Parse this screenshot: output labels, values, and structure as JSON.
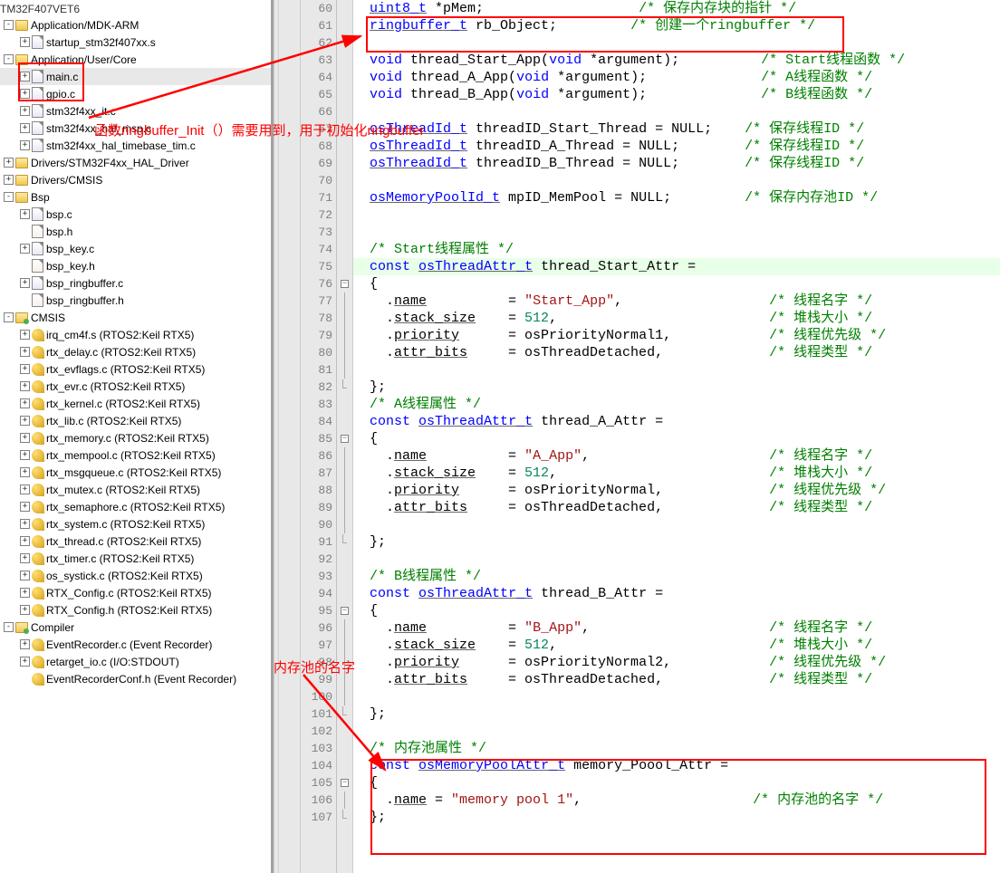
{
  "title_fragment": "TM32F407VET6",
  "tree": [
    {
      "depth": 0,
      "exp": "-",
      "icon": "folder",
      "label": "Application/MDK-ARM"
    },
    {
      "depth": 1,
      "exp": "+",
      "icon": "file-c",
      "label": "startup_stm32f407xx.s"
    },
    {
      "depth": 0,
      "exp": "-",
      "icon": "folder",
      "label": "Application/User/Core",
      "boxed": true
    },
    {
      "depth": 1,
      "exp": "+",
      "icon": "file-c",
      "label": "main.c",
      "selected": true,
      "boxed_child": true
    },
    {
      "depth": 1,
      "exp": "+",
      "icon": "file-c",
      "label": "gpio.c"
    },
    {
      "depth": 1,
      "exp": "+",
      "icon": "file-c",
      "label": "stm32f4xx_it.c"
    },
    {
      "depth": 1,
      "exp": "+",
      "icon": "file-c",
      "label": "stm32f4xx_hal_msp.c"
    },
    {
      "depth": 1,
      "exp": "+",
      "icon": "file-c",
      "label": "stm32f4xx_hal_timebase_tim.c"
    },
    {
      "depth": 0,
      "exp": "+",
      "icon": "folder",
      "label": "Drivers/STM32F4xx_HAL_Driver"
    },
    {
      "depth": 0,
      "exp": "+",
      "icon": "folder",
      "label": "Drivers/CMSIS"
    },
    {
      "depth": 0,
      "exp": "-",
      "icon": "folder",
      "label": "Bsp"
    },
    {
      "depth": 1,
      "exp": "+",
      "icon": "file-c",
      "label": "bsp.c"
    },
    {
      "depth": 1,
      "exp": "",
      "icon": "file-h",
      "label": "bsp.h"
    },
    {
      "depth": 1,
      "exp": "+",
      "icon": "file-c",
      "label": "bsp_key.c"
    },
    {
      "depth": 1,
      "exp": "",
      "icon": "file-h",
      "label": "bsp_key.h"
    },
    {
      "depth": 1,
      "exp": "+",
      "icon": "file-c",
      "label": "bsp_ringbuffer.c"
    },
    {
      "depth": 1,
      "exp": "",
      "icon": "file-h",
      "label": "bsp_ringbuffer.h"
    },
    {
      "depth": 0,
      "exp": "-",
      "icon": "folder-green",
      "label": "CMSIS"
    },
    {
      "depth": 1,
      "exp": "+",
      "icon": "key",
      "label": "irq_cm4f.s (RTOS2:Keil RTX5)"
    },
    {
      "depth": 1,
      "exp": "+",
      "icon": "key",
      "label": "rtx_delay.c (RTOS2:Keil RTX5)"
    },
    {
      "depth": 1,
      "exp": "+",
      "icon": "key",
      "label": "rtx_evflags.c (RTOS2:Keil RTX5)"
    },
    {
      "depth": 1,
      "exp": "+",
      "icon": "key",
      "label": "rtx_evr.c (RTOS2:Keil RTX5)"
    },
    {
      "depth": 1,
      "exp": "+",
      "icon": "key",
      "label": "rtx_kernel.c (RTOS2:Keil RTX5)"
    },
    {
      "depth": 1,
      "exp": "+",
      "icon": "key",
      "label": "rtx_lib.c (RTOS2:Keil RTX5)"
    },
    {
      "depth": 1,
      "exp": "+",
      "icon": "key",
      "label": "rtx_memory.c (RTOS2:Keil RTX5)"
    },
    {
      "depth": 1,
      "exp": "+",
      "icon": "key",
      "label": "rtx_mempool.c (RTOS2:Keil RTX5)"
    },
    {
      "depth": 1,
      "exp": "+",
      "icon": "key",
      "label": "rtx_msgqueue.c (RTOS2:Keil RTX5)"
    },
    {
      "depth": 1,
      "exp": "+",
      "icon": "key",
      "label": "rtx_mutex.c (RTOS2:Keil RTX5)"
    },
    {
      "depth": 1,
      "exp": "+",
      "icon": "key",
      "label": "rtx_semaphore.c (RTOS2:Keil RTX5)"
    },
    {
      "depth": 1,
      "exp": "+",
      "icon": "key",
      "label": "rtx_system.c (RTOS2:Keil RTX5)"
    },
    {
      "depth": 1,
      "exp": "+",
      "icon": "key",
      "label": "rtx_thread.c (RTOS2:Keil RTX5)"
    },
    {
      "depth": 1,
      "exp": "+",
      "icon": "key",
      "label": "rtx_timer.c (RTOS2:Keil RTX5)"
    },
    {
      "depth": 1,
      "exp": "+",
      "icon": "key",
      "label": "os_systick.c (RTOS2:Keil RTX5)"
    },
    {
      "depth": 1,
      "exp": "+",
      "icon": "key",
      "label": "RTX_Config.c (RTOS2:Keil RTX5)"
    },
    {
      "depth": 1,
      "exp": "+",
      "icon": "key",
      "label": "RTX_Config.h (RTOS2:Keil RTX5)"
    },
    {
      "depth": 0,
      "exp": "-",
      "icon": "folder-green",
      "label": "Compiler"
    },
    {
      "depth": 1,
      "exp": "+",
      "icon": "key",
      "label": "EventRecorder.c (Event Recorder)"
    },
    {
      "depth": 1,
      "exp": "+",
      "icon": "key",
      "label": "retarget_io.c (I/O:STDOUT)"
    },
    {
      "depth": 1,
      "exp": "",
      "icon": "key",
      "label": "EventRecorderConf.h (Event Recorder)"
    }
  ],
  "code": [
    {
      "n": 60,
      "fold": "",
      "tokens": [
        {
          "p": "  "
        },
        {
          "c": "ty u",
          "t": "uint8_t"
        },
        {
          "p": " *pMem;                   "
        },
        {
          "c": "cmt",
          "t": "/* 保存内存块的指针 */"
        }
      ]
    },
    {
      "n": 61,
      "fold": "",
      "tokens": [
        {
          "p": "  "
        },
        {
          "c": "ty u",
          "t": "ringbuffer_t"
        },
        {
          "p": " rb_Object;         "
        },
        {
          "c": "cmt",
          "t": "/* 创建一个ringbuffer */"
        }
      ]
    },
    {
      "n": 62,
      "fold": "",
      "tokens": []
    },
    {
      "n": 63,
      "fold": "",
      "tokens": [
        {
          "p": "  "
        },
        {
          "c": "kw",
          "t": "void"
        },
        {
          "p": " thread_Start_App("
        },
        {
          "c": "kw",
          "t": "void"
        },
        {
          "p": " *argument);          "
        },
        {
          "c": "cmt",
          "t": "/* Start线程函数 */"
        }
      ]
    },
    {
      "n": 64,
      "fold": "",
      "tokens": [
        {
          "p": "  "
        },
        {
          "c": "kw",
          "t": "void"
        },
        {
          "p": " thread_A_App("
        },
        {
          "c": "kw",
          "t": "void"
        },
        {
          "p": " *argument);              "
        },
        {
          "c": "cmt",
          "t": "/* A线程函数 */"
        }
      ]
    },
    {
      "n": 65,
      "fold": "",
      "tokens": [
        {
          "p": "  "
        },
        {
          "c": "kw",
          "t": "void"
        },
        {
          "p": " thread_B_App("
        },
        {
          "c": "kw",
          "t": "void"
        },
        {
          "p": " *argument);              "
        },
        {
          "c": "cmt",
          "t": "/* B线程函数 */"
        }
      ]
    },
    {
      "n": 66,
      "fold": "",
      "tokens": []
    },
    {
      "n": 67,
      "fold": "",
      "tokens": [
        {
          "p": "  "
        },
        {
          "c": "ty u",
          "t": "osThreadId_t"
        },
        {
          "p": " threadID_Start_Thread = NULL;    "
        },
        {
          "c": "cmt",
          "t": "/* 保存线程ID */"
        }
      ]
    },
    {
      "n": 68,
      "fold": "",
      "tokens": [
        {
          "p": "  "
        },
        {
          "c": "ty u",
          "t": "osThreadId_t"
        },
        {
          "p": " threadID_A_Thread = NULL;        "
        },
        {
          "c": "cmt",
          "t": "/* 保存线程ID */"
        }
      ]
    },
    {
      "n": 69,
      "fold": "",
      "tokens": [
        {
          "p": "  "
        },
        {
          "c": "ty u",
          "t": "osThreadId_t"
        },
        {
          "p": " threadID_B_Thread = NULL;        "
        },
        {
          "c": "cmt",
          "t": "/* 保存线程ID */"
        }
      ]
    },
    {
      "n": 70,
      "fold": "",
      "tokens": []
    },
    {
      "n": 71,
      "fold": "",
      "tokens": [
        {
          "p": "  "
        },
        {
          "c": "ty u",
          "t": "osMemoryPoolId_t"
        },
        {
          "p": " mpID_MemPool = NULL;         "
        },
        {
          "c": "cmt",
          "t": "/* 保存内存池ID */"
        }
      ]
    },
    {
      "n": 72,
      "fold": "",
      "tokens": []
    },
    {
      "n": 73,
      "fold": "",
      "tokens": []
    },
    {
      "n": 74,
      "fold": "",
      "tokens": [
        {
          "p": "  "
        },
        {
          "c": "cmt",
          "t": "/* Start线程属性 */"
        }
      ]
    },
    {
      "n": 75,
      "fold": "",
      "hl": true,
      "tokens": [
        {
          "p": "  "
        },
        {
          "c": "kw",
          "t": "const"
        },
        {
          "p": " "
        },
        {
          "c": "ty u",
          "t": "osThreadAttr_t"
        },
        {
          "p": " thread_Start_Attr ="
        }
      ]
    },
    {
      "n": 76,
      "fold": "-",
      "tokens": [
        {
          "p": "  {"
        }
      ]
    },
    {
      "n": 77,
      "fold": "|",
      "tokens": [
        {
          "p": "    ."
        },
        {
          "c": "id u",
          "t": "name"
        },
        {
          "p": "          = "
        },
        {
          "c": "str",
          "t": "\"Start_App\""
        },
        {
          "p": ",                  "
        },
        {
          "c": "cmt",
          "t": "/* 线程名字 */"
        }
      ]
    },
    {
      "n": 78,
      "fold": "|",
      "tokens": [
        {
          "p": "    ."
        },
        {
          "c": "id u",
          "t": "stack_size"
        },
        {
          "p": "    = "
        },
        {
          "c": "num",
          "t": "512"
        },
        {
          "p": ",                          "
        },
        {
          "c": "cmt",
          "t": "/* 堆栈大小 */"
        }
      ]
    },
    {
      "n": 79,
      "fold": "|",
      "tokens": [
        {
          "p": "    ."
        },
        {
          "c": "id u",
          "t": "priority"
        },
        {
          "p": "      = osPriorityNormal1,            "
        },
        {
          "c": "cmt",
          "t": "/* 线程优先级 */"
        }
      ]
    },
    {
      "n": 80,
      "fold": "|",
      "tokens": [
        {
          "p": "    ."
        },
        {
          "c": "id u",
          "t": "attr_bits"
        },
        {
          "p": "     = osThreadDetached,             "
        },
        {
          "c": "cmt",
          "t": "/* 线程类型 */"
        }
      ]
    },
    {
      "n": 81,
      "fold": "|",
      "tokens": []
    },
    {
      "n": 82,
      "fold": "e",
      "tokens": [
        {
          "p": "  };"
        }
      ]
    },
    {
      "n": 83,
      "fold": "",
      "tokens": [
        {
          "p": "  "
        },
        {
          "c": "cmt",
          "t": "/* A线程属性 */"
        }
      ]
    },
    {
      "n": 84,
      "fold": "",
      "tokens": [
        {
          "p": "  "
        },
        {
          "c": "kw",
          "t": "const"
        },
        {
          "p": " "
        },
        {
          "c": "ty u",
          "t": "osThreadAttr_t"
        },
        {
          "p": " thread_A_Attr ="
        }
      ]
    },
    {
      "n": 85,
      "fold": "-",
      "tokens": [
        {
          "p": "  {"
        }
      ]
    },
    {
      "n": 86,
      "fold": "|",
      "tokens": [
        {
          "p": "    ."
        },
        {
          "c": "id u",
          "t": "name"
        },
        {
          "p": "          = "
        },
        {
          "c": "str",
          "t": "\"A_App\""
        },
        {
          "p": ",                      "
        },
        {
          "c": "cmt",
          "t": "/* 线程名字 */"
        }
      ]
    },
    {
      "n": 87,
      "fold": "|",
      "tokens": [
        {
          "p": "    ."
        },
        {
          "c": "id u",
          "t": "stack_size"
        },
        {
          "p": "    = "
        },
        {
          "c": "num",
          "t": "512"
        },
        {
          "p": ",                          "
        },
        {
          "c": "cmt",
          "t": "/* 堆栈大小 */"
        }
      ]
    },
    {
      "n": 88,
      "fold": "|",
      "tokens": [
        {
          "p": "    ."
        },
        {
          "c": "id u",
          "t": "priority"
        },
        {
          "p": "      = osPriorityNormal,             "
        },
        {
          "c": "cmt",
          "t": "/* 线程优先级 */"
        }
      ]
    },
    {
      "n": 89,
      "fold": "|",
      "tokens": [
        {
          "p": "    ."
        },
        {
          "c": "id u",
          "t": "attr_bits"
        },
        {
          "p": "     = osThreadDetached,             "
        },
        {
          "c": "cmt",
          "t": "/* 线程类型 */"
        }
      ]
    },
    {
      "n": 90,
      "fold": "|",
      "tokens": []
    },
    {
      "n": 91,
      "fold": "e",
      "tokens": [
        {
          "p": "  };"
        }
      ]
    },
    {
      "n": 92,
      "fold": "",
      "tokens": []
    },
    {
      "n": 93,
      "fold": "",
      "tokens": [
        {
          "p": "  "
        },
        {
          "c": "cmt",
          "t": "/* B线程属性 */"
        }
      ]
    },
    {
      "n": 94,
      "fold": "",
      "tokens": [
        {
          "p": "  "
        },
        {
          "c": "kw",
          "t": "const"
        },
        {
          "p": " "
        },
        {
          "c": "ty u",
          "t": "osThreadAttr_t"
        },
        {
          "p": " thread_B_Attr ="
        }
      ]
    },
    {
      "n": 95,
      "fold": "-",
      "tokens": [
        {
          "p": "  {"
        }
      ]
    },
    {
      "n": 96,
      "fold": "|",
      "tokens": [
        {
          "p": "    ."
        },
        {
          "c": "id u",
          "t": "name"
        },
        {
          "p": "          = "
        },
        {
          "c": "str",
          "t": "\"B_App\""
        },
        {
          "p": ",                      "
        },
        {
          "c": "cmt",
          "t": "/* 线程名字 */"
        }
      ]
    },
    {
      "n": 97,
      "fold": "|",
      "tokens": [
        {
          "p": "    ."
        },
        {
          "c": "id u",
          "t": "stack_size"
        },
        {
          "p": "    = "
        },
        {
          "c": "num",
          "t": "512"
        },
        {
          "p": ",                          "
        },
        {
          "c": "cmt",
          "t": "/* 堆栈大小 */"
        }
      ]
    },
    {
      "n": 98,
      "fold": "|",
      "tokens": [
        {
          "p": "    ."
        },
        {
          "c": "id u",
          "t": "priority"
        },
        {
          "p": "      = osPriorityNormal2,            "
        },
        {
          "c": "cmt",
          "t": "/* 线程优先级 */"
        }
      ]
    },
    {
      "n": 99,
      "fold": "|",
      "tokens": [
        {
          "p": "    ."
        },
        {
          "c": "id u",
          "t": "attr_bits"
        },
        {
          "p": "     = osThreadDetached,             "
        },
        {
          "c": "cmt",
          "t": "/* 线程类型 */"
        }
      ]
    },
    {
      "n": 100,
      "fold": "|",
      "tokens": []
    },
    {
      "n": 101,
      "fold": "e",
      "tokens": [
        {
          "p": "  };"
        }
      ]
    },
    {
      "n": 102,
      "fold": "",
      "tokens": []
    },
    {
      "n": 103,
      "fold": "",
      "tokens": [
        {
          "p": "  "
        },
        {
          "c": "cmt",
          "t": "/* 内存池属性 */"
        }
      ]
    },
    {
      "n": 104,
      "fold": "",
      "tokens": [
        {
          "p": "  "
        },
        {
          "c": "kw",
          "t": "const"
        },
        {
          "p": " "
        },
        {
          "c": "ty u",
          "t": "osMemoryPoolAttr_t"
        },
        {
          "p": " memory_Poool_Attr ="
        }
      ]
    },
    {
      "n": 105,
      "fold": "-",
      "tokens": [
        {
          "p": "  {"
        }
      ]
    },
    {
      "n": 106,
      "fold": "|",
      "tokens": [
        {
          "p": "    ."
        },
        {
          "c": "id u",
          "t": "name"
        },
        {
          "p": " = "
        },
        {
          "c": "str",
          "t": "\"memory pool 1\""
        },
        {
          "p": ",                     "
        },
        {
          "c": "cmt",
          "t": "/* 内存池的名字 */"
        }
      ]
    },
    {
      "n": 107,
      "fold": "e",
      "tokens": [
        {
          "p": "  };"
        }
      ]
    }
  ],
  "annotations": {
    "text1": "函数ringbuffer_Init（）需要用到，用于初始化ringbuffer",
    "text2": "内存池的名字"
  }
}
